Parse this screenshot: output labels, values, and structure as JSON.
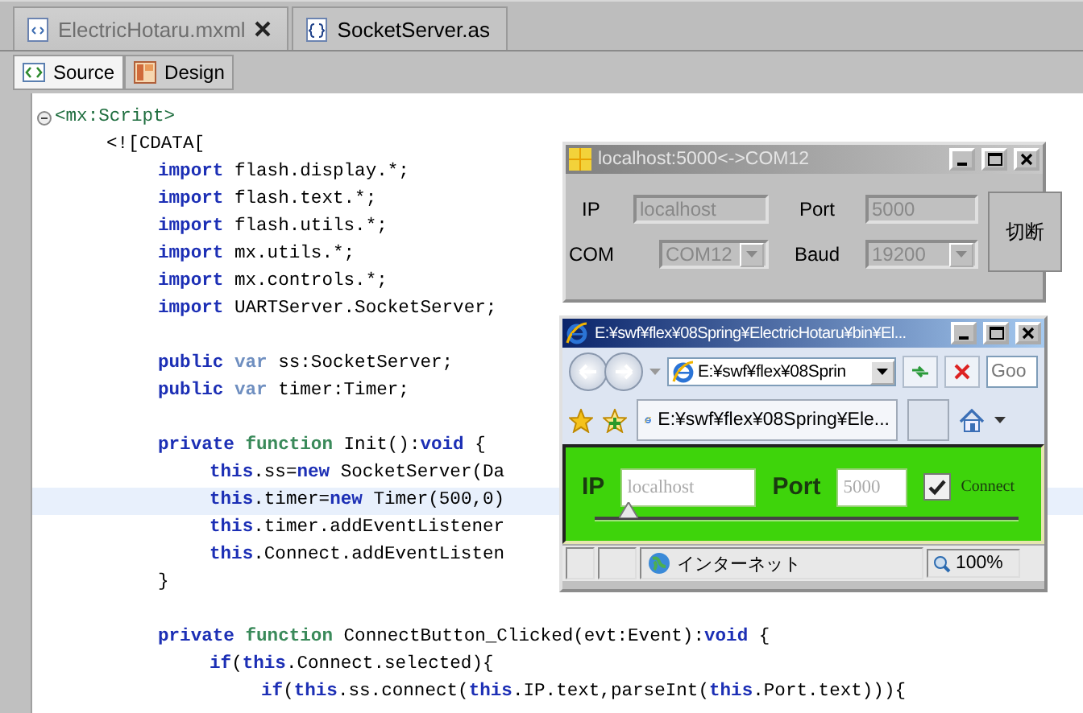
{
  "editor_tabs": [
    {
      "label": "ElectricHotaru.mxml",
      "selected": true,
      "kind": "mxml",
      "closable": true
    },
    {
      "label": "SocketServer.as",
      "selected": false,
      "kind": "as",
      "closable": false
    }
  ],
  "view_buttons": [
    {
      "label": "Source",
      "selected": true,
      "kind": "source"
    },
    {
      "label": "Design",
      "selected": false,
      "kind": "design"
    }
  ],
  "code_lines": [
    {
      "kind": "code",
      "collapsible": true,
      "segments": [
        {
          "kind": "tag",
          "text": "<mx:Script>"
        }
      ]
    },
    {
      "kind": "code",
      "segments": [
        {
          "kind": "plain",
          "text": "\t<![CDATA["
        }
      ]
    },
    {
      "kind": "code",
      "segments": [
        {
          "kind": "keyword",
          "text": "\t\timport"
        },
        {
          "kind": "plain",
          "text": " flash.display.*;"
        }
      ]
    },
    {
      "kind": "code",
      "segments": [
        {
          "kind": "keyword",
          "text": "\t\timport"
        },
        {
          "kind": "plain",
          "text": " flash.text.*;"
        }
      ]
    },
    {
      "kind": "code",
      "segments": [
        {
          "kind": "keyword",
          "text": "\t\timport"
        },
        {
          "kind": "plain",
          "text": " flash.utils.*;"
        }
      ]
    },
    {
      "kind": "code",
      "segments": [
        {
          "kind": "keyword",
          "text": "\t\timport"
        },
        {
          "kind": "plain",
          "text": " mx.utils.*;"
        }
      ]
    },
    {
      "kind": "code",
      "segments": [
        {
          "kind": "keyword",
          "text": "\t\timport"
        },
        {
          "kind": "plain",
          "text": " mx.controls.*;"
        }
      ]
    },
    {
      "kind": "code",
      "segments": [
        {
          "kind": "keyword",
          "text": "\t\timport"
        },
        {
          "kind": "plain",
          "text": " UARTServer.SocketServer;"
        }
      ]
    },
    {
      "kind": "blank"
    },
    {
      "kind": "code",
      "segments": [
        {
          "kind": "keyword",
          "text": "\t\tpublic"
        },
        {
          "kind": "var",
          "text": " var"
        },
        {
          "kind": "plain",
          "text": " ss:SocketServer;"
        }
      ]
    },
    {
      "kind": "code",
      "segments": [
        {
          "kind": "keyword",
          "text": "\t\tpublic"
        },
        {
          "kind": "var",
          "text": " var"
        },
        {
          "kind": "plain",
          "text": " timer:Timer;"
        }
      ]
    },
    {
      "kind": "blank"
    },
    {
      "kind": "code",
      "segments": [
        {
          "kind": "keyword",
          "text": "\t\tprivate"
        },
        {
          "kind": "function",
          "text": " function"
        },
        {
          "kind": "plain",
          "text": " Init():"
        },
        {
          "kind": "keyword",
          "text": "void"
        },
        {
          "kind": "plain",
          "text": " {"
        }
      ]
    },
    {
      "kind": "code",
      "segments": [
        {
          "kind": "keyword",
          "text": "\t\t\tthis"
        },
        {
          "kind": "plain",
          "text": ".ss="
        },
        {
          "kind": "keyword",
          "text": "new"
        },
        {
          "kind": "plain",
          "text": " SocketServer(Da"
        }
      ]
    },
    {
      "kind": "code",
      "highlighted": true,
      "segments": [
        {
          "kind": "keyword",
          "text": "\t\t\tthis"
        },
        {
          "kind": "plain",
          "text": ".timer="
        },
        {
          "kind": "keyword",
          "text": "new"
        },
        {
          "kind": "plain",
          "text": " Timer(500,0)"
        }
      ]
    },
    {
      "kind": "code",
      "segments": [
        {
          "kind": "keyword",
          "text": "\t\t\tthis"
        },
        {
          "kind": "plain",
          "text": ".timer.addEventListener"
        }
      ]
    },
    {
      "kind": "code",
      "segments": [
        {
          "kind": "keyword",
          "text": "\t\t\tthis"
        },
        {
          "kind": "plain",
          "text": ".Connect.addEventListen"
        }
      ]
    },
    {
      "kind": "code",
      "segments": [
        {
          "kind": "plain",
          "text": "\t\t}"
        }
      ]
    },
    {
      "kind": "blank"
    },
    {
      "kind": "code",
      "segments": [
        {
          "kind": "keyword",
          "text": "\t\tprivate"
        },
        {
          "kind": "function",
          "text": " function"
        },
        {
          "kind": "plain",
          "text": " ConnectButton_Clicked(evt:Event):"
        },
        {
          "kind": "keyword",
          "text": "void"
        },
        {
          "kind": "plain",
          "text": " {"
        }
      ]
    },
    {
      "kind": "code",
      "segments": [
        {
          "kind": "keyword",
          "text": "\t\t\tif"
        },
        {
          "kind": "plain",
          "text": "("
        },
        {
          "kind": "keyword",
          "text": "this"
        },
        {
          "kind": "plain",
          "text": ".Connect.selected){"
        }
      ]
    },
    {
      "kind": "code",
      "segments": [
        {
          "kind": "keyword",
          "text": "\t\t\t\tif"
        },
        {
          "kind": "plain",
          "text": "("
        },
        {
          "kind": "keyword",
          "text": "this"
        },
        {
          "kind": "plain",
          "text": ".ss.connect("
        },
        {
          "kind": "keyword",
          "text": "this"
        },
        {
          "kind": "plain",
          "text": ".IP.text,parseInt("
        },
        {
          "kind": "keyword",
          "text": "this"
        },
        {
          "kind": "plain",
          "text": ".Port.text))){"
        }
      ]
    }
  ],
  "server_window": {
    "title": "localhost:5000<->COM12",
    "active": false,
    "ip_label": "IP",
    "ip_value": "localhost",
    "port_label": "Port",
    "port_value": "5000",
    "com_label": "COM",
    "com_value": "COM12",
    "baud_label": "Baud",
    "baud_value": "19200",
    "disabled": true,
    "disconnect_button": "切断"
  },
  "browser_window": {
    "title": "E:¥swf¥flex¥08Spring¥ElectricHotaru¥bin¥El...",
    "active": true,
    "address": "E:¥swf¥flex¥08Sprin",
    "search_placeholder": "Goo",
    "tab_label": "E:¥swf¥flex¥08Spring¥Ele...",
    "app": {
      "ip_label": "IP",
      "ip_value": "localhost",
      "port_label": "Port",
      "port_value": "5000",
      "connect_label": "Connect",
      "connect_checked": true,
      "slider": {
        "level": 0.08
      }
    },
    "status_zone": "インターネット",
    "zoom": "100%"
  }
}
